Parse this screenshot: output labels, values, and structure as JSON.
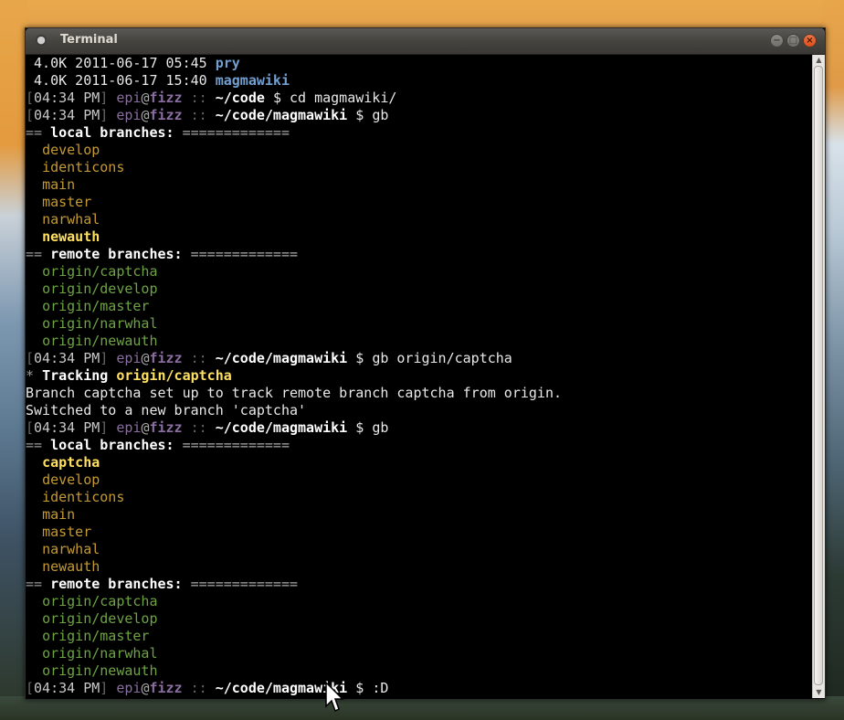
{
  "window": {
    "title": "Terminal",
    "controls": {
      "minimize": "−",
      "maximize": "□",
      "close": "×"
    },
    "app_icon": "terminal-icon"
  },
  "prompt": {
    "open": "[",
    "close": "]",
    "time": "04:34 PM",
    "user": "epi",
    "at": "@",
    "host": "fizz",
    "sep": "::",
    "dollar": "$"
  },
  "lines": {
    "ls1": {
      "size": " 4.0K 2011-06-17 05:45 ",
      "name": "pry"
    },
    "ls2": {
      "size": " 4.0K 2011-06-17 15:40 ",
      "name": "magmawiki"
    },
    "p1": {
      "path": "~/code",
      "cmd": "cd magmawiki/"
    },
    "p2": {
      "path": "~/code/magmawiki",
      "cmd": "gb"
    },
    "local_header_1": {
      "eq": "==",
      "title": "local branches:",
      "rule": "============="
    },
    "local_1": [
      "develop",
      "identicons",
      "main",
      "master",
      "narwhal"
    ],
    "local_1_current": "newauth",
    "remote_header_1": {
      "eq": "==",
      "title": "remote branches:",
      "rule": "============="
    },
    "remote_1": [
      "origin/captcha",
      "origin/develop",
      "origin/master",
      "origin/narwhal",
      "origin/newauth"
    ],
    "p3": {
      "path": "~/code/magmawiki",
      "cmd": "gb origin/captcha"
    },
    "tracking": {
      "star": "*",
      "label": "Tracking",
      "branch": "origin/captcha"
    },
    "out1": "Branch captcha set up to track remote branch captcha from origin.",
    "out2": "Switched to a new branch 'captcha'",
    "p4": {
      "path": "~/code/magmawiki",
      "cmd": "gb"
    },
    "local_header_2": {
      "eq": "==",
      "title": "local branches:",
      "rule": "============="
    },
    "local_2_current": "captcha",
    "local_2": [
      "develop",
      "identicons",
      "main",
      "master",
      "narwhal",
      "newauth"
    ],
    "remote_header_2": {
      "eq": "==",
      "title": "remote branches:",
      "rule": "============="
    },
    "remote_2": [
      "origin/captcha",
      "origin/develop",
      "origin/master",
      "origin/narwhal",
      "origin/newauth"
    ],
    "p5": {
      "path": "~/code/magmawiki",
      "cmd": ":D"
    }
  },
  "colors": {
    "local_branch": "#c49a33",
    "current_branch": "#ffe060",
    "remote_branch": "#6ea344",
    "user_host": "#8a6ea0",
    "directory": "#729fcf",
    "close_button": "#df4a16"
  }
}
